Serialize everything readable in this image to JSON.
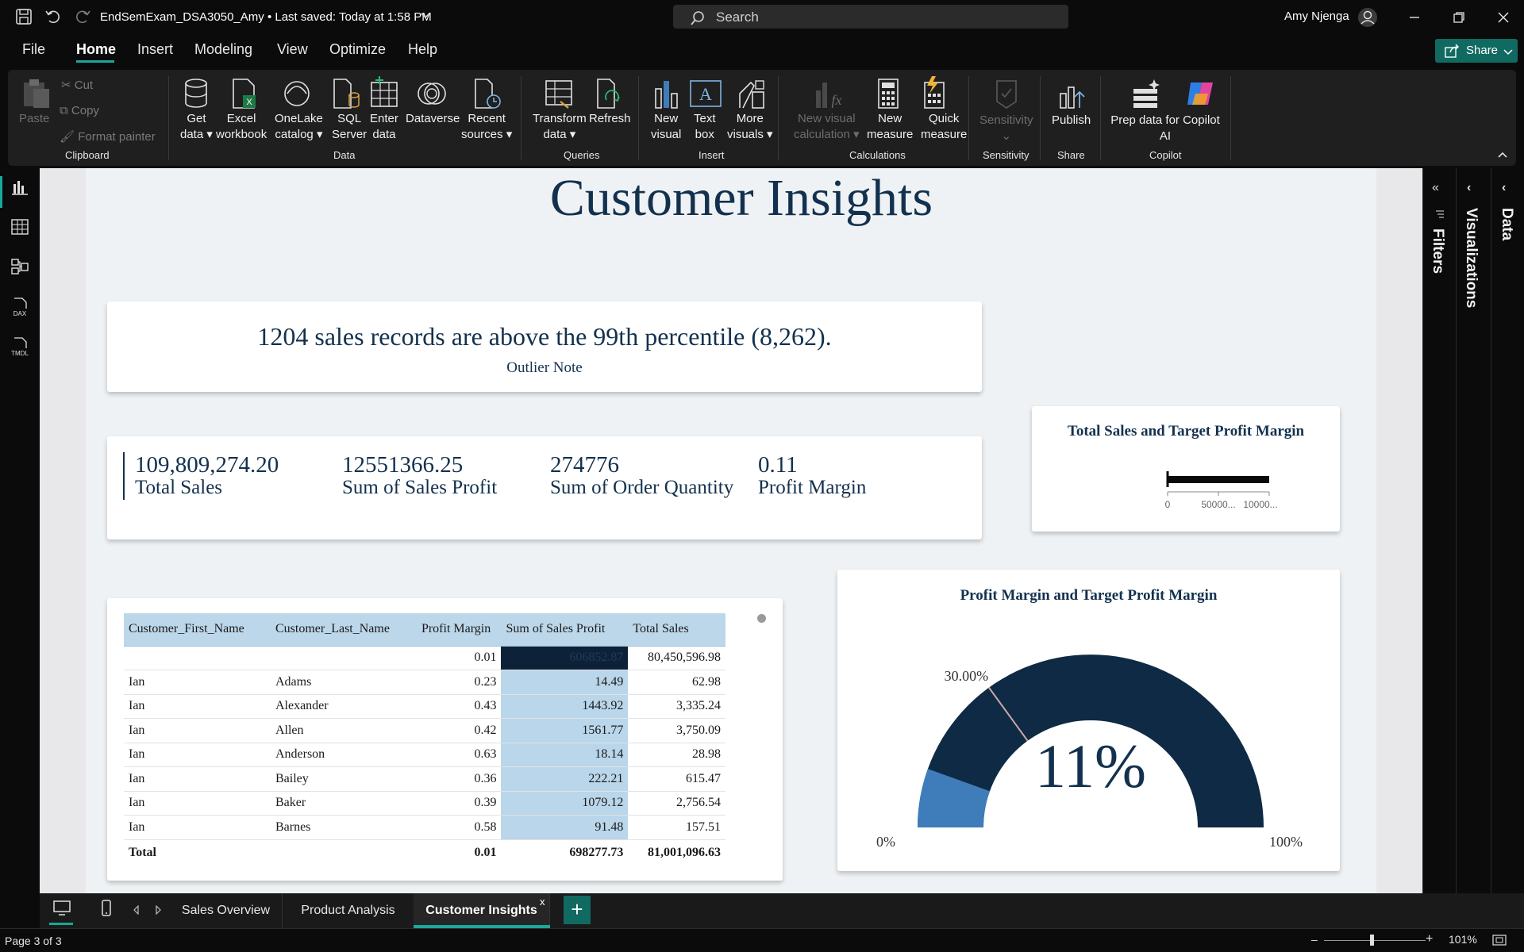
{
  "titlebar": {
    "doc_title": "EndSemExam_DSA3050_Amy • Last saved: Today at 1:58 PM",
    "search_placeholder": "Search",
    "user_name": "Amy Njenga"
  },
  "menu": {
    "file": "File",
    "home": "Home",
    "insert": "Insert",
    "modeling": "Modeling",
    "view": "View",
    "optimize": "Optimize",
    "help": "Help",
    "share": "Share"
  },
  "ribbon": {
    "clipboard": {
      "paste": "Paste",
      "cut": "Cut",
      "copy": "Copy",
      "format_painter": "Format painter",
      "group": "Clipboard"
    },
    "data": {
      "get_data_1": "Get",
      "get_data_2": "data",
      "excel_1": "Excel",
      "excel_2": "workbook",
      "onelake_1": "OneLake",
      "onelake_2": "catalog",
      "sql_1": "SQL",
      "sql_2": "Server",
      "enter_1": "Enter",
      "enter_2": "data",
      "dataverse": "Dataverse",
      "recent_1": "Recent",
      "recent_2": "sources",
      "group": "Data"
    },
    "queries": {
      "transform_1": "Transform",
      "transform_2": "data",
      "refresh": "Refresh",
      "group": "Queries"
    },
    "insert": {
      "new_visual_1": "New",
      "new_visual_2": "visual",
      "text_box_1": "Text",
      "text_box_2": "box",
      "more_visuals_1": "More",
      "more_visuals_2": "visuals",
      "group": "Insert"
    },
    "calculations": {
      "new_visual_calc_1": "New visual",
      "new_visual_calc_2": "calculation",
      "new_measure_1": "New",
      "new_measure_2": "measure",
      "quick_measure_1": "Quick",
      "quick_measure_2": "measure",
      "group": "Calculations"
    },
    "sensitivity": {
      "label": "Sensitivity",
      "group": "Sensitivity"
    },
    "share": {
      "publish": "Publish",
      "group": "Share"
    },
    "copilot": {
      "prep_1": "Prep data for Copilot",
      "prep_2": "AI",
      "group": "Copilot"
    }
  },
  "report": {
    "title": "Customer Insights",
    "outlier": {
      "text": "1204 sales records are above the 99th percentile (8,262).",
      "label": "Outlier Note"
    },
    "kpis": [
      {
        "value": "109,809,274.20",
        "label": "Total Sales"
      },
      {
        "value": "12551366.25",
        "label": "Sum of Sales Profit"
      },
      {
        "value": "274776",
        "label": "Sum of Order Quantity"
      },
      {
        "value": "0.11",
        "label": "Profit Margin"
      }
    ],
    "bullet": {
      "title": "Total Sales and Target Profit Margin",
      "ticks": [
        "0",
        "50000...",
        "10000..."
      ]
    },
    "table": {
      "columns": [
        "Customer_First_Name",
        "Customer_Last_Name",
        "Profit Margin",
        "Sum of Sales Profit",
        "Total Sales"
      ],
      "rows": [
        [
          "",
          "",
          "0.01",
          "606852.87",
          "80,450,596.98"
        ],
        [
          "Ian",
          "Adams",
          "0.23",
          "14.49",
          "62.98"
        ],
        [
          "Ian",
          "Alexander",
          "0.43",
          "1443.92",
          "3,335.24"
        ],
        [
          "Ian",
          "Allen",
          "0.42",
          "1561.77",
          "3,750.09"
        ],
        [
          "Ian",
          "Anderson",
          "0.63",
          "18.14",
          "28.98"
        ],
        [
          "Ian",
          "Bailey",
          "0.36",
          "222.21",
          "615.47"
        ],
        [
          "Ian",
          "Baker",
          "0.39",
          "1079.12",
          "2,756.54"
        ],
        [
          "Ian",
          "Barnes",
          "0.58",
          "91.48",
          "157.51"
        ]
      ],
      "total": [
        "Total",
        "",
        "0.01",
        "698277.73",
        "81,001,096.63"
      ]
    },
    "gauge": {
      "title": "Profit Margin and Target Profit Margin",
      "value_label": "11%",
      "value": 0.11,
      "target": 0.3,
      "target_label": "30.00%",
      "min_label": "0%",
      "max_label": "100%",
      "fill_color": "#3f7cba",
      "track_color": "#0f2a44"
    }
  },
  "panes": {
    "filters": "Filters",
    "visualizations": "Visualizations",
    "data": "Data"
  },
  "tabs": [
    {
      "label": "Sales Overview"
    },
    {
      "label": "Product Analysis"
    },
    {
      "label": "Customer Insights"
    }
  ],
  "tab_close": "x",
  "status": {
    "page": "Page 3 of 3",
    "zoom": "101%"
  }
}
